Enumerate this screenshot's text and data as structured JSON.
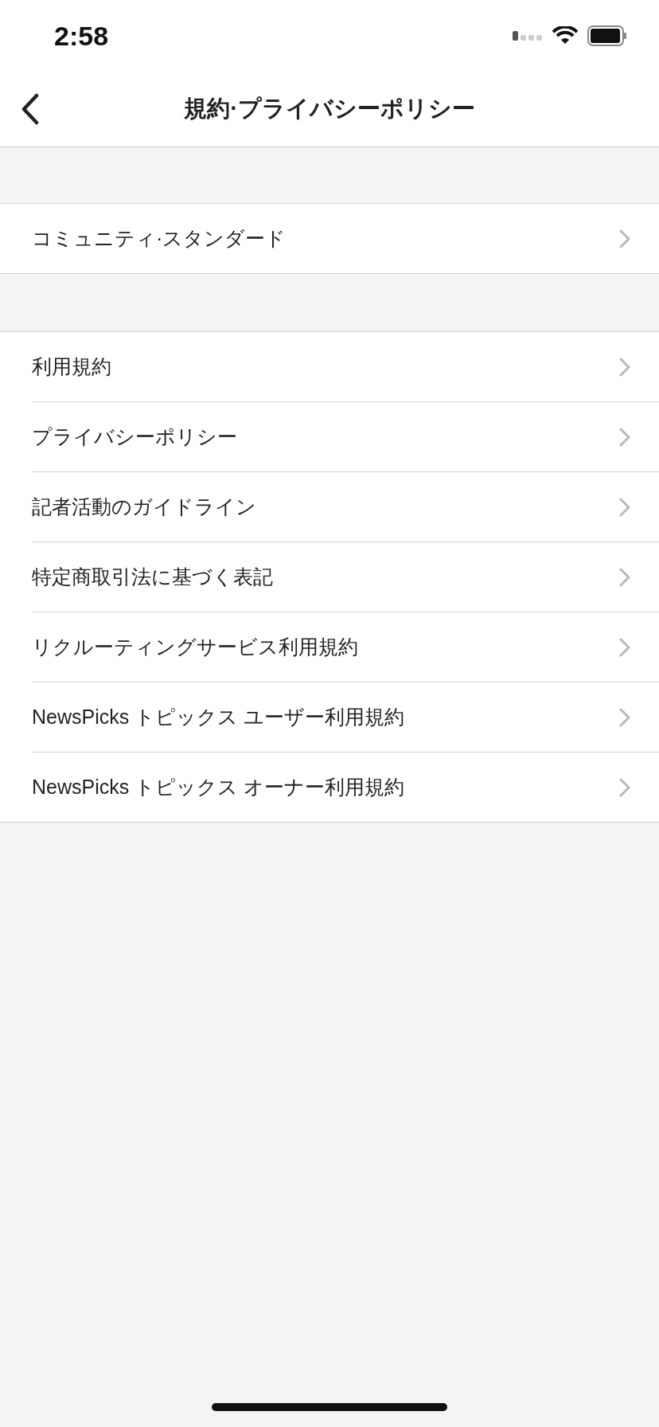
{
  "status_bar": {
    "time": "2:58"
  },
  "nav": {
    "title": "規約·プライバシーポリシー"
  },
  "sections": [
    {
      "items": [
        {
          "label": "コミュニティ·スタンダード"
        }
      ]
    },
    {
      "items": [
        {
          "label": "利用規約"
        },
        {
          "label": "プライバシーポリシー"
        },
        {
          "label": "記者活動のガイドライン"
        },
        {
          "label": "特定商取引法に基づく表記"
        },
        {
          "label": "リクルーティングサービス利用規約"
        },
        {
          "label": "NewsPicks トピックス ユーザー利用規約"
        },
        {
          "label": "NewsPicks トピックス オーナー利用規約"
        }
      ]
    }
  ]
}
